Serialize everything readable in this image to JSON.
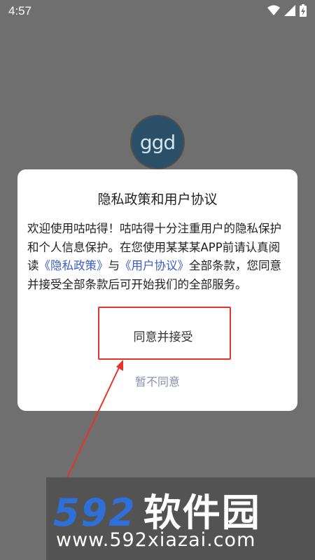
{
  "status_bar": {
    "time": "4:57"
  },
  "logo": {
    "text": "ggd"
  },
  "dialog": {
    "title": "隐私政策和用户协议",
    "body_part1": "欢迎使用咕咕得！咕咕得十分注重用户的隐私保护和个人信息保护。在您使用某某某APP前请认真阅读",
    "privacy_link": "《隐私政策》",
    "body_and": "与",
    "terms_link": "《用户协议》",
    "body_part2": "全部条款，您同意并接受全部条款后可开始我们的全部服务。",
    "accept_label": "同意并接受",
    "decline_label": "暂不同意"
  },
  "watermark": {
    "brand": "592",
    "brand_cn": "软件园",
    "url": "www.592xiazai.com"
  },
  "colors": {
    "overlay": "#6f6f6f",
    "link": "#3a5dc9",
    "highlight": "#e8332b",
    "decline": "#8a8fb0"
  }
}
